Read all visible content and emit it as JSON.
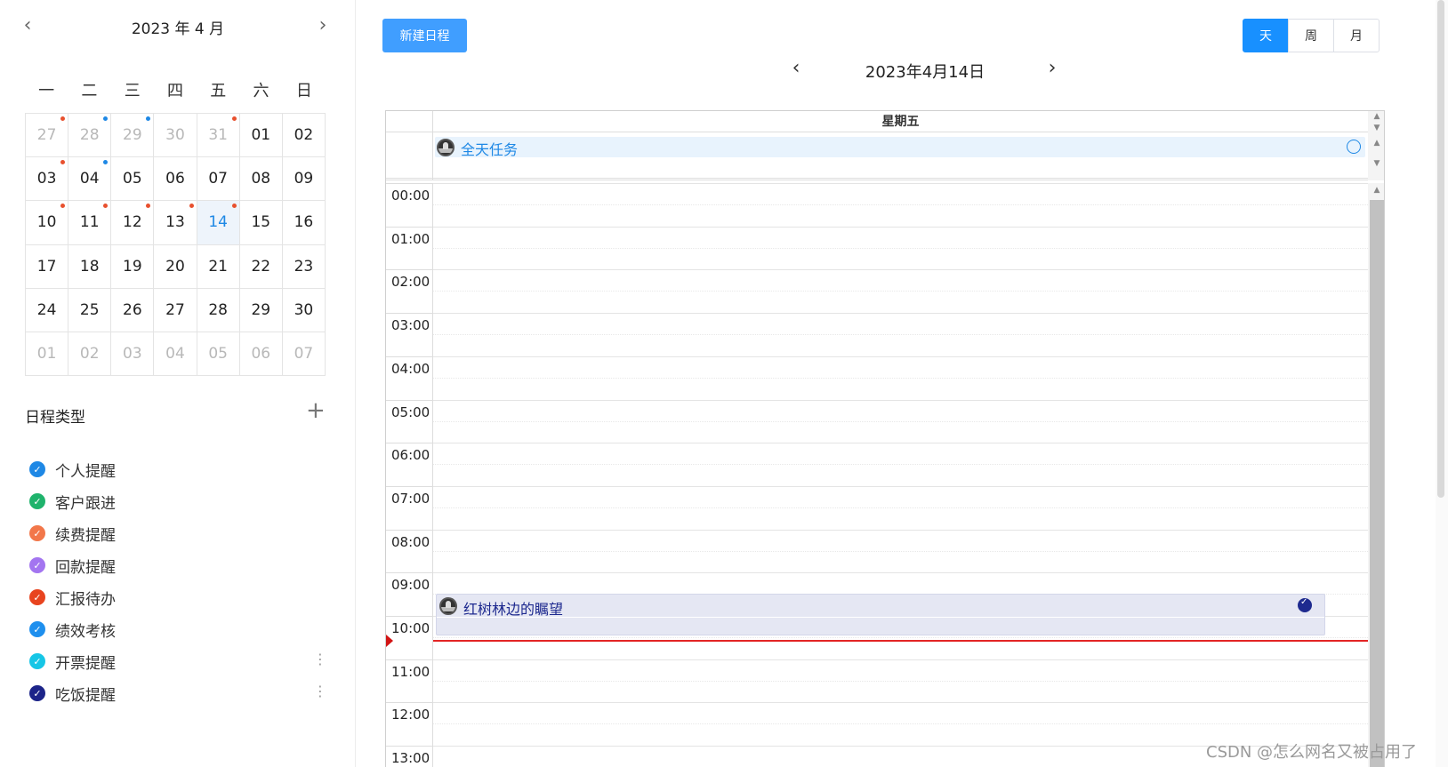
{
  "mini_calendar": {
    "title": "2023 年 4 月",
    "prev_icon": "‹",
    "next_icon": "›",
    "weekdays": [
      "一",
      "二",
      "三",
      "四",
      "五",
      "六",
      "日"
    ],
    "days": [
      {
        "label": "27",
        "other": true,
        "dot": "red"
      },
      {
        "label": "28",
        "other": true,
        "dot": "blue"
      },
      {
        "label": "29",
        "other": true,
        "dot": "blue"
      },
      {
        "label": "30",
        "other": true,
        "dot": ""
      },
      {
        "label": "31",
        "other": true,
        "dot": "red"
      },
      {
        "label": "01",
        "other": false,
        "dot": ""
      },
      {
        "label": "02",
        "other": false,
        "dot": ""
      },
      {
        "label": "03",
        "other": false,
        "dot": "red"
      },
      {
        "label": "04",
        "other": false,
        "dot": "blue"
      },
      {
        "label": "05",
        "other": false,
        "dot": ""
      },
      {
        "label": "06",
        "other": false,
        "dot": ""
      },
      {
        "label": "07",
        "other": false,
        "dot": ""
      },
      {
        "label": "08",
        "other": false,
        "dot": ""
      },
      {
        "label": "09",
        "other": false,
        "dot": ""
      },
      {
        "label": "10",
        "other": false,
        "dot": "red"
      },
      {
        "label": "11",
        "other": false,
        "dot": "red"
      },
      {
        "label": "12",
        "other": false,
        "dot": "red"
      },
      {
        "label": "13",
        "other": false,
        "dot": "red"
      },
      {
        "label": "14",
        "other": false,
        "dot": "red",
        "selected": true
      },
      {
        "label": "15",
        "other": false,
        "dot": ""
      },
      {
        "label": "16",
        "other": false,
        "dot": ""
      },
      {
        "label": "17",
        "other": false,
        "dot": ""
      },
      {
        "label": "18",
        "other": false,
        "dot": ""
      },
      {
        "label": "19",
        "other": false,
        "dot": ""
      },
      {
        "label": "20",
        "other": false,
        "dot": ""
      },
      {
        "label": "21",
        "other": false,
        "dot": ""
      },
      {
        "label": "22",
        "other": false,
        "dot": ""
      },
      {
        "label": "23",
        "other": false,
        "dot": ""
      },
      {
        "label": "24",
        "other": false,
        "dot": ""
      },
      {
        "label": "25",
        "other": false,
        "dot": ""
      },
      {
        "label": "26",
        "other": false,
        "dot": ""
      },
      {
        "label": "27",
        "other": false,
        "dot": ""
      },
      {
        "label": "28",
        "other": false,
        "dot": ""
      },
      {
        "label": "29",
        "other": false,
        "dot": ""
      },
      {
        "label": "30",
        "other": false,
        "dot": ""
      },
      {
        "label": "01",
        "other": true,
        "dot": ""
      },
      {
        "label": "02",
        "other": true,
        "dot": ""
      },
      {
        "label": "03",
        "other": true,
        "dot": ""
      },
      {
        "label": "04",
        "other": true,
        "dot": ""
      },
      {
        "label": "05",
        "other": true,
        "dot": ""
      },
      {
        "label": "06",
        "other": true,
        "dot": ""
      },
      {
        "label": "07",
        "other": true,
        "dot": ""
      }
    ]
  },
  "schedule_types": {
    "title": "日程类型",
    "add_icon": "+",
    "items": [
      {
        "label": "个人提醒",
        "color": "#1e88e5",
        "more": false
      },
      {
        "label": "客户跟进",
        "color": "#1fb36c",
        "more": false
      },
      {
        "label": "续费提醒",
        "color": "#f2774a",
        "more": false
      },
      {
        "label": "回款提醒",
        "color": "#a375f0",
        "more": false
      },
      {
        "label": "汇报待办",
        "color": "#e8441f",
        "more": false
      },
      {
        "label": "绩效考核",
        "color": "#1e8fee",
        "more": false
      },
      {
        "label": "开票提醒",
        "color": "#16c6e6",
        "more": true
      },
      {
        "label": "吃饭提醒",
        "color": "#1c2489",
        "more": true
      }
    ],
    "more_icon": "⋮"
  },
  "toolbar": {
    "new_button": "新建日程",
    "views": [
      "天",
      "周",
      "月"
    ],
    "active_view": "天"
  },
  "date_nav": {
    "title": "2023年4月14日",
    "prev_icon": "‹",
    "next_icon": "›"
  },
  "scheduler": {
    "day_header": "星期五",
    "allday_event": {
      "title": "全天任务"
    },
    "timed_event": {
      "title": "红树林边的瞩望",
      "start": "09:30",
      "end": "10:30"
    },
    "now_time": "10:30",
    "hours": [
      "00:00",
      "01:00",
      "02:00",
      "03:00",
      "04:00",
      "05:00",
      "06:00",
      "07:00",
      "08:00",
      "09:00",
      "10:00",
      "11:00",
      "12:00",
      "13:00"
    ]
  },
  "watermark": "CSDN @怎么网名又被占用了"
}
